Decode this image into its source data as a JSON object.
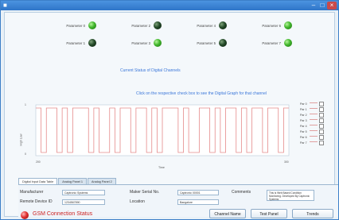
{
  "parameters": [
    {
      "label": "Parameter 0",
      "state": "on"
    },
    {
      "label": "Parameter 2",
      "state": "off"
    },
    {
      "label": "Parameter 4",
      "state": "off"
    },
    {
      "label": "Parameter 6",
      "state": "on"
    },
    {
      "label": "Parameter 1",
      "state": "off"
    },
    {
      "label": "Parameter 3",
      "state": "on"
    },
    {
      "label": "Parameter 5",
      "state": "off"
    },
    {
      "label": "Parameter 7",
      "state": "on"
    }
  ],
  "status_title": "Current Status of Digital Channels",
  "instructions": "Click on the respective check box to see the Digital Graph for that channel",
  "chart_data": {
    "type": "line",
    "xlabel": "Time",
    "ylabel": "High Low",
    "x_ticks": [
      "200",
      "300"
    ],
    "y_ticks": [
      "0",
      "1"
    ],
    "ylim": [
      0,
      1
    ],
    "series": [
      {
        "name": "Par 0",
        "values": [
          1,
          0,
          1,
          1,
          0,
          1,
          0,
          1,
          1,
          1,
          0,
          1,
          0,
          0,
          1,
          0,
          1,
          1,
          0,
          1,
          1,
          0,
          1,
          0,
          1,
          1,
          1,
          0,
          1,
          0,
          0,
          1,
          1,
          0,
          1,
          0,
          1,
          1,
          0,
          1,
          0,
          1,
          1,
          0,
          1,
          1,
          0,
          1
        ]
      }
    ]
  },
  "legend": [
    {
      "name": "Par 0"
    },
    {
      "name": "Par 1"
    },
    {
      "name": "Par 2"
    },
    {
      "name": "Par 3"
    },
    {
      "name": "Par 4"
    },
    {
      "name": "Par 5"
    },
    {
      "name": "Par 6"
    },
    {
      "name": "Par 7"
    }
  ],
  "tabs": [
    {
      "label": "Digital Input Data Table"
    },
    {
      "label": "Analog Panel 1"
    },
    {
      "label": "Analog Panel 2"
    }
  ],
  "info": {
    "manufacturer_label": "Manufacturer",
    "manufacturer_value": "Captronic Systems",
    "remote_label": "Remote Device ID",
    "remote_value": "1234567890",
    "maker_label": "Maker Serial No.",
    "maker_value": "Captronic 00001",
    "location_label": "Location",
    "location_value": "Bangalore",
    "comments_label": "Comments",
    "comments_value": "This is Web Based Condition Monitoring. Developed By Captronic Systems"
  },
  "gsm_label": "GSM Connection Status",
  "buttons": {
    "channel_name": "Channel Name",
    "test_panel": "Test Panel",
    "trends": "Trends"
  },
  "colors": {
    "led_on": "#41b62c",
    "led_off": "#234a28",
    "signal": "#e58a8a",
    "accent_text": "#3a76d9",
    "gsm": "#cc2222"
  }
}
